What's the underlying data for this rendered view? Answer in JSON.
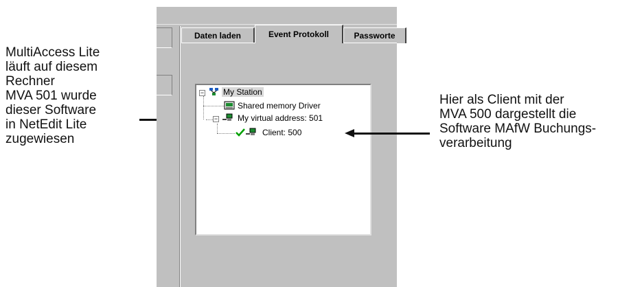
{
  "left_callout": {
    "lines": [
      "MultiAccess Lite",
      "läuft auf diesem",
      "Rechner",
      "MVA 501 wurde",
      "dieser Software",
      "in NetEdit Lite",
      "zugewiesen"
    ]
  },
  "right_callout": {
    "lines": [
      "Hier als Client mit der",
      "MVA 500 dargestellt die",
      "Software MAfW Buchungs-",
      "verarbeitung"
    ]
  },
  "tabs": [
    "Daten laden",
    "Event Protokoll",
    "Passworte"
  ],
  "active_tab": "Event Protokoll",
  "tree": {
    "root": "My Station",
    "driver": "Shared memory Driver",
    "virtual_address": "My virtual address: 501",
    "client": "Client: 500"
  },
  "icons": {
    "root": "network-station-icon",
    "driver": "memory-driver-icon",
    "virtual_address": "computer-icon",
    "client": "computer-icon",
    "client_status": "checkmark-icon"
  },
  "colors": {
    "window_bg": "#c0c0c0",
    "check_green": "#00a000"
  }
}
